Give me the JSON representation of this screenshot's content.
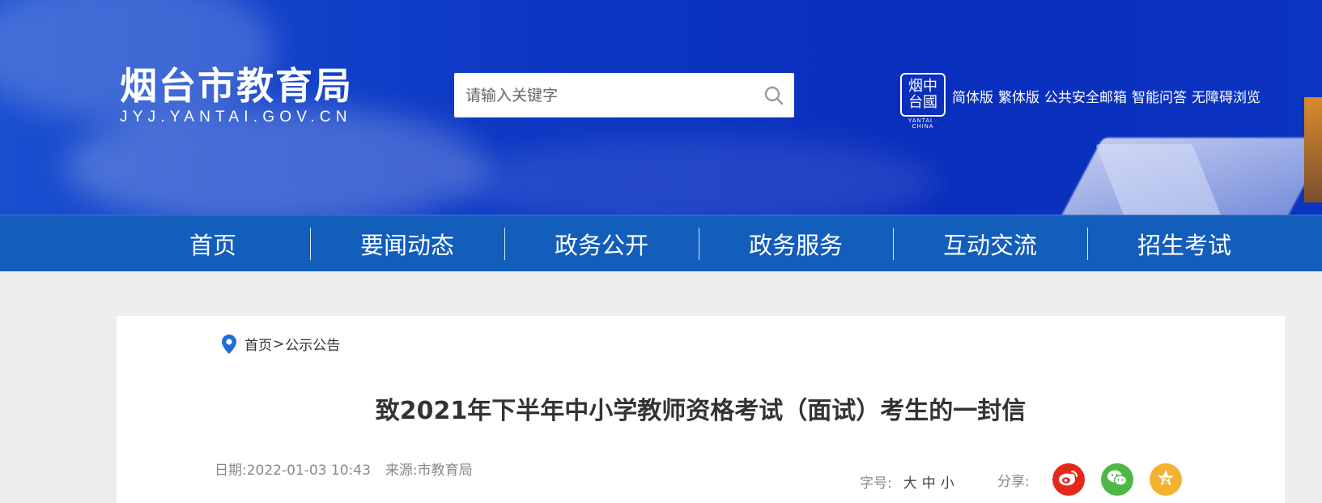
{
  "header": {
    "logo_cn": "烟台市教育局",
    "logo_en": "JYJ.YANTAI.GOV.CN",
    "search": {
      "placeholder": "请输入关键字",
      "value": ""
    },
    "seal": {
      "glyphs": "烟中台國",
      "caption": "YANTAI · CHINA"
    },
    "top_links": [
      "简体版",
      "繁体版",
      "公共安全邮箱",
      "智能问答",
      "无障碍浏览"
    ]
  },
  "nav": {
    "items": [
      "首页",
      "要闻动态",
      "政务公开",
      "政务服务",
      "互动交流",
      "招生考试"
    ]
  },
  "article": {
    "breadcrumb": {
      "home": "首页",
      "sep": ">",
      "current": "公示公告"
    },
    "title": "致2021年下半年中小学教师资格考试（面试）考生的一封信",
    "date": "日期:2022-01-03 10:43",
    "source": "来源:市教育局",
    "font_size": {
      "label": "字号:",
      "large": "大",
      "medium": "中",
      "small": "小"
    },
    "share": {
      "label": "分享:",
      "buttons": [
        {
          "name": "weibo",
          "color": "#e6281c",
          "icon": "weibo-icon"
        },
        {
          "name": "wechat",
          "color": "#4cb848",
          "icon": "wechat-icon"
        },
        {
          "name": "qzone",
          "color": "#f4b132",
          "icon": "star-icon"
        }
      ]
    }
  },
  "colors": {
    "nav_bg": "#135dbb",
    "banner_blue": "#0c37c4",
    "page_bg": "#eeeeee"
  }
}
